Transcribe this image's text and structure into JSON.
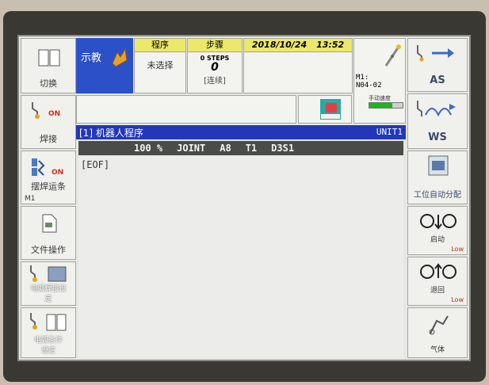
{
  "mode": {
    "label": "示教"
  },
  "header": {
    "program_label": "程序",
    "program_value": "未选择",
    "steps_label": "步骤",
    "steps_count_label": "0 STEPS",
    "steps_value": "0",
    "run_mode": "[连续]",
    "date": "2018/10/24",
    "time": "13:52",
    "robot_id_line1": "M1:",
    "robot_id_line2": "N04-02",
    "speed_label": "手动速度"
  },
  "program_window": {
    "title": "[1] 机器人程序",
    "unit": "UNIT1",
    "status": {
      "speed": "100 %",
      "coord": "JOINT",
      "a": "A8",
      "t": "T1",
      "d": "D3S1"
    },
    "eof": "[EOF]"
  },
  "left_menu": [
    {
      "label": "切换"
    },
    {
      "label": "焊接",
      "on": "ON"
    },
    {
      "label": "摆焊运条",
      "sub": "M1",
      "on": "ON"
    },
    {
      "label": "文件操作"
    },
    {
      "label": "电弧焊接设定"
    },
    {
      "label": "电弧条件设定"
    }
  ],
  "right_menu": [
    {
      "label": "AS"
    },
    {
      "label": "WS"
    },
    {
      "label": "工位自动分配"
    },
    {
      "label": "启动",
      "sub": "Low"
    },
    {
      "label": "退回",
      "sub": "Low"
    },
    {
      "label": "气体"
    }
  ],
  "colors": {
    "mode_blue": "#2c50c8",
    "title_blue": "#2238b8",
    "header_yellow": "#ece86a",
    "status_dark": "#4a4c48",
    "speed_green": "#18b818"
  }
}
